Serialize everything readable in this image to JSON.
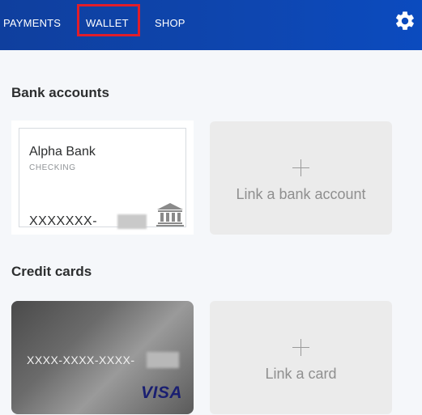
{
  "nav": {
    "items": [
      "PAYMENTS",
      "WALLET",
      "SHOP"
    ],
    "active": "WALLET",
    "highlight_color": "#e11d2a",
    "settings_icon": "gear-icon"
  },
  "sections": {
    "bank_accounts": "Bank accounts",
    "credit_cards": "Credit cards"
  },
  "bank_account": {
    "name": "Alpha Bank",
    "type": "CHECKING",
    "number": "XXXXXXX-",
    "icon": "bank-icon"
  },
  "link_bank": {
    "label": "Link a bank account",
    "icon": "plus-icon"
  },
  "credit_card": {
    "number": "XXXX-XXXX-XXXX-",
    "brand": "VISA"
  },
  "link_card": {
    "label": "Link a card",
    "icon": "plus-icon"
  },
  "colors": {
    "header_blue": "#0e46b0",
    "visa_blue": "#1a1f71",
    "text_dark": "#2c2e2f"
  }
}
